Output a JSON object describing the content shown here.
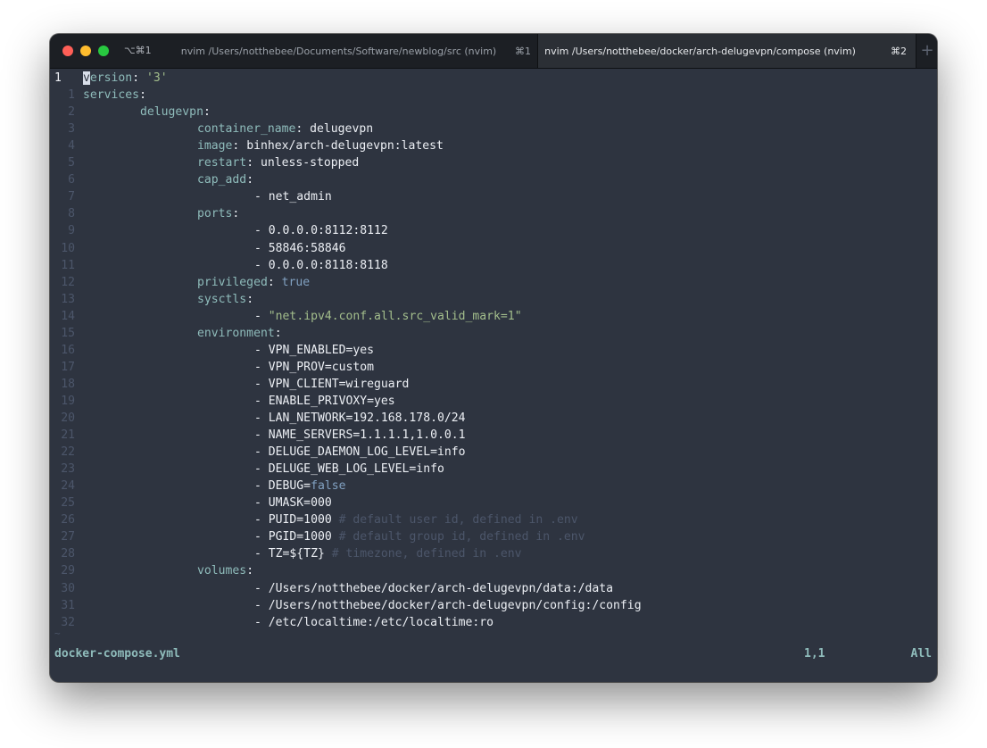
{
  "window": {
    "shortcut": "⌥⌘1",
    "tabs": [
      {
        "title": "nvim /Users/notthebee/Documents/Software/newblog/src (nvim)",
        "key": "⌘1",
        "active": false
      },
      {
        "title": "nvim /Users/notthebee/docker/arch-delugevpn/compose (nvim)",
        "key": "⌘2",
        "active": true
      }
    ],
    "new_tab_icon": "plus-icon"
  },
  "editor": {
    "lines": [
      {
        "num": "1",
        "current": true,
        "indent": 0,
        "parts": [
          {
            "t": "v",
            "c": "cursor"
          },
          {
            "t": "ersion",
            "c": "key"
          },
          {
            "t": ": "
          },
          {
            "t": "'3'",
            "c": "str"
          }
        ]
      },
      {
        "num": "1",
        "indent": 0,
        "parts": [
          {
            "t": "services",
            "c": "key"
          },
          {
            "t": ":"
          }
        ]
      },
      {
        "num": "2",
        "indent": 1,
        "parts": [
          {
            "t": "delugevpn",
            "c": "key"
          },
          {
            "t": ":"
          }
        ]
      },
      {
        "num": "3",
        "indent": 2,
        "parts": [
          {
            "t": "container_name",
            "c": "key"
          },
          {
            "t": ": delugevpn"
          }
        ]
      },
      {
        "num": "4",
        "indent": 2,
        "parts": [
          {
            "t": "image",
            "c": "key"
          },
          {
            "t": ": binhex/arch-delugevpn:latest"
          }
        ]
      },
      {
        "num": "5",
        "indent": 2,
        "parts": [
          {
            "t": "restart",
            "c": "key"
          },
          {
            "t": ": unless-stopped"
          }
        ]
      },
      {
        "num": "6",
        "indent": 2,
        "parts": [
          {
            "t": "cap_add",
            "c": "key"
          },
          {
            "t": ":"
          }
        ]
      },
      {
        "num": "7",
        "indent": 3,
        "parts": [
          {
            "t": "- net_admin"
          }
        ]
      },
      {
        "num": "8",
        "indent": 2,
        "parts": [
          {
            "t": "ports",
            "c": "key"
          },
          {
            "t": ":"
          }
        ]
      },
      {
        "num": "9",
        "indent": 3,
        "parts": [
          {
            "t": "- 0.0.0.0:8112:8112"
          }
        ]
      },
      {
        "num": "10",
        "indent": 3,
        "parts": [
          {
            "t": "- 58846:58846"
          }
        ]
      },
      {
        "num": "11",
        "indent": 3,
        "parts": [
          {
            "t": "- 0.0.0.0:8118:8118"
          }
        ]
      },
      {
        "num": "12",
        "indent": 2,
        "parts": [
          {
            "t": "privileged",
            "c": "key"
          },
          {
            "t": ": "
          },
          {
            "t": "true",
            "c": "bool"
          }
        ]
      },
      {
        "num": "13",
        "indent": 2,
        "parts": [
          {
            "t": "sysctls",
            "c": "key"
          },
          {
            "t": ":"
          }
        ]
      },
      {
        "num": "14",
        "indent": 3,
        "parts": [
          {
            "t": "- "
          },
          {
            "t": "\"net.ipv4.conf.all.src_valid_mark=1\"",
            "c": "str"
          }
        ]
      },
      {
        "num": "15",
        "indent": 2,
        "parts": [
          {
            "t": "environment",
            "c": "key"
          },
          {
            "t": ":"
          }
        ]
      },
      {
        "num": "16",
        "indent": 3,
        "parts": [
          {
            "t": "- VPN_ENABLED=yes"
          }
        ]
      },
      {
        "num": "17",
        "indent": 3,
        "parts": [
          {
            "t": "- VPN_PROV=custom"
          }
        ]
      },
      {
        "num": "18",
        "indent": 3,
        "parts": [
          {
            "t": "- VPN_CLIENT=wireguard"
          }
        ]
      },
      {
        "num": "19",
        "indent": 3,
        "parts": [
          {
            "t": "- ENABLE_PRIVOXY=yes"
          }
        ]
      },
      {
        "num": "20",
        "indent": 3,
        "parts": [
          {
            "t": "- LAN_NETWORK=192.168.178.0/24"
          }
        ]
      },
      {
        "num": "21",
        "indent": 3,
        "parts": [
          {
            "t": "- NAME_SERVERS=1.1.1.1,1.0.0.1"
          }
        ]
      },
      {
        "num": "22",
        "indent": 3,
        "parts": [
          {
            "t": "- DELUGE_DAEMON_LOG_LEVEL=info"
          }
        ]
      },
      {
        "num": "23",
        "indent": 3,
        "parts": [
          {
            "t": "- DELUGE_WEB_LOG_LEVEL=info"
          }
        ]
      },
      {
        "num": "24",
        "indent": 3,
        "parts": [
          {
            "t": "- DEBUG="
          },
          {
            "t": "false",
            "c": "bool"
          }
        ]
      },
      {
        "num": "25",
        "indent": 3,
        "parts": [
          {
            "t": "- UMASK=000"
          }
        ]
      },
      {
        "num": "26",
        "indent": 3,
        "parts": [
          {
            "t": "- PUID=1000 "
          },
          {
            "t": "# default user id, defined in .env",
            "c": "comment"
          }
        ]
      },
      {
        "num": "27",
        "indent": 3,
        "parts": [
          {
            "t": "- PGID=1000 "
          },
          {
            "t": "# default group id, defined in .env",
            "c": "comment"
          }
        ]
      },
      {
        "num": "28",
        "indent": 3,
        "parts": [
          {
            "t": "- TZ=${TZ} "
          },
          {
            "t": "# timezone, defined in .env",
            "c": "comment"
          }
        ]
      },
      {
        "num": "29",
        "indent": 2,
        "parts": [
          {
            "t": "volumes",
            "c": "key"
          },
          {
            "t": ":"
          }
        ]
      },
      {
        "num": "30",
        "indent": 3,
        "parts": [
          {
            "t": "- /Users/notthebee/docker/arch-delugevpn/data:/data"
          }
        ]
      },
      {
        "num": "31",
        "indent": 3,
        "parts": [
          {
            "t": "- /Users/notthebee/docker/arch-delugevpn/config:/config"
          }
        ]
      },
      {
        "num": "32",
        "indent": 3,
        "parts": [
          {
            "t": "- /etc/localtime:/etc/localtime:ro"
          }
        ]
      }
    ],
    "end_marker": "~"
  },
  "statusline": {
    "filename": "docker-compose.yml",
    "position": "1,1",
    "scroll": "All"
  },
  "colors": {
    "background": "#2e3440",
    "key": "#8fbcbb",
    "string": "#a3be8c",
    "boolean": "#81a1c1",
    "comment": "#4c566a"
  }
}
